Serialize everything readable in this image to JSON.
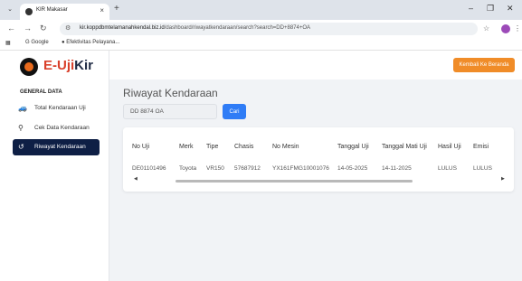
{
  "browser": {
    "tab_title": "KIR Makasar",
    "new_tab_icon": "+",
    "url_host": "kir.koppdbmtelamanahkendal.biz.id",
    "url_path": "/dashboard/riwayatkendaraan/search?search=DD+8874+OA",
    "bookmarks": [
      "Google",
      "Efektivitas Pelayana..."
    ]
  },
  "app": {
    "brand_part1": "E-Uji",
    "brand_part2": "Kir",
    "back_button": "Kembali Ke Beranda",
    "sidebar": {
      "section_title": "GENERAL DATA",
      "items": [
        {
          "label": "Total Kendaraan Uji",
          "icon": "car-icon",
          "glyph": "🚙"
        },
        {
          "label": "Cek Data Kendaraan",
          "icon": "search-icon",
          "glyph": "⚲"
        },
        {
          "label": "Riwayat Kendaraan",
          "icon": "history-icon",
          "glyph": "↺",
          "active": true
        }
      ]
    },
    "page_title": "Riwayat Kendaraan",
    "search": {
      "value": "DD 8874 OA",
      "button": "Cari"
    },
    "table": {
      "columns": [
        "No Uji",
        "Merk",
        "Tipe",
        "Chasis",
        "No Mesin",
        "Tanggal Uji",
        "Tanggal Mati Uji",
        "Hasil Uji",
        "Emisi"
      ],
      "rows": [
        [
          "DE01101496",
          "Toyota",
          "VR150",
          "57687912",
          "YX161FMG10001076",
          "14-05-2025",
          "14-11-2025",
          "LULUS",
          "LULUS"
        ]
      ]
    }
  },
  "colors": {
    "accent": "#f08c28",
    "primary": "#2f7cf6",
    "sidebar_active": "#0e1f45",
    "brand_red": "#d9402b"
  }
}
